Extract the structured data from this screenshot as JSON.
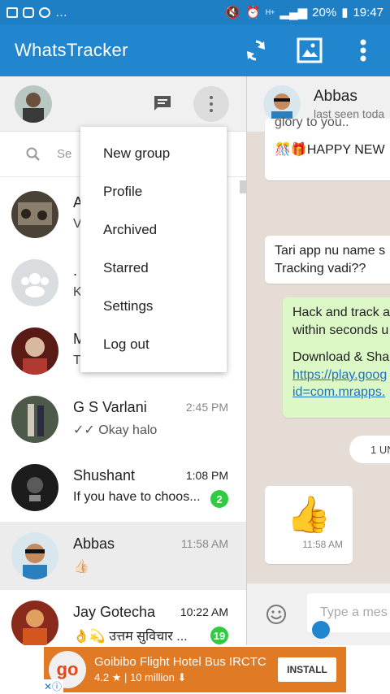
{
  "status_bar": {
    "battery": "20%",
    "time": "19:47",
    "network": "H+"
  },
  "app_bar": {
    "title": "WhatsTracker",
    "icons": [
      "refresh-icon",
      "image-icon",
      "more-vert-icon"
    ]
  },
  "left_pane": {
    "search": {
      "placeholder": "Se"
    }
  },
  "menu": {
    "items": [
      "New group",
      "Profile",
      "Archived",
      "Starred",
      "Settings",
      "Log out"
    ]
  },
  "chats": [
    {
      "name": "A",
      "time": "",
      "message": "V",
      "badge": ""
    },
    {
      "name": ".",
      "time": "",
      "message": "K",
      "badge": ""
    },
    {
      "name": "M",
      "time": "",
      "message": "T",
      "badge": ""
    },
    {
      "name": "G S Varlani",
      "time": "2:45 PM",
      "message": "✓✓ Okay halo",
      "badge": ""
    },
    {
      "name": "Shushant",
      "time": "1:08 PM",
      "message": "If you have to choos...",
      "badge": "2"
    },
    {
      "name": "Abbas",
      "time": "11:58 AM",
      "message": "👍🏻",
      "badge": ""
    },
    {
      "name": "Jay Gotecha",
      "time": "10:22 AM",
      "message": "👌💫 उत्तम सुविचार ...",
      "badge": "19"
    }
  ],
  "conversation": {
    "name": "Abbas",
    "status": "last seen toda",
    "messages": [
      {
        "text": "glory to you..",
        "direction": "in"
      },
      {
        "text": "🎊🎁HAPPY NEW",
        "direction": "in"
      },
      {
        "text": "Tari app nu name s",
        "direction": "in"
      },
      {
        "text": "Tracking vadi??",
        "direction": "in"
      },
      {
        "text": "Hack and track a",
        "direction": "out"
      },
      {
        "text": "within seconds u",
        "direction": "out"
      },
      {
        "text": "Download & Sha",
        "direction": "out"
      },
      {
        "text": "https://play.goog",
        "direction": "out"
      },
      {
        "text": "id=com.mrapps.",
        "direction": "out"
      },
      {
        "text": "👍",
        "direction": "in"
      },
      {
        "text": "11:58 AM",
        "direction": "in"
      }
    ],
    "date_pill": "1 UN",
    "input_placeholder": "Type a mes"
  },
  "ad": {
    "logo": "go",
    "title": "Goibibo Flight Hotel Bus IRCTC",
    "rating": "4.2",
    "installs": "10 million",
    "button": "INSTALL"
  },
  "colors": {
    "primary": "#2286cf",
    "status": "#1f7fc4",
    "conversation_bg": "#e5ddd5",
    "outgoing_bubble": "#dcf8c6",
    "badge": "#2ecc40",
    "ad_bg": "#e07a25"
  }
}
